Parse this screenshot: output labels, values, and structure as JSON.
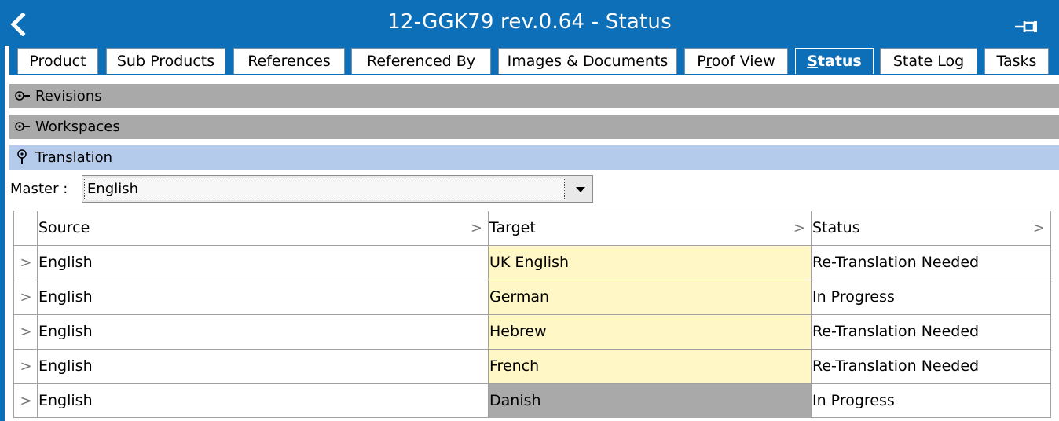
{
  "window": {
    "title": "12-GGK79 rev.0.64 - Status",
    "back_icon": "chevron-left-icon",
    "pin_icon": "pin-icon",
    "accent_color": "#0d6fb8"
  },
  "tabs": [
    {
      "label": "Product",
      "active": false
    },
    {
      "label": "Sub Products",
      "active": false
    },
    {
      "label": "References",
      "active": false
    },
    {
      "label": "Referenced By",
      "active": false
    },
    {
      "label": "Images & Documents",
      "active": false
    },
    {
      "label": "Proof View",
      "active": false
    },
    {
      "label": "Status",
      "active": true
    },
    {
      "label": "State Log",
      "active": false
    },
    {
      "label": "Tasks",
      "active": false
    }
  ],
  "sections": [
    {
      "label": "Revisions",
      "expanded": false
    },
    {
      "label": "Workspaces",
      "expanded": false
    },
    {
      "label": "Translation",
      "expanded": true
    }
  ],
  "translation": {
    "master_label": "Master :",
    "master_value": "English",
    "columns": [
      "Source",
      "Target",
      "Status"
    ],
    "rows": [
      {
        "source": "English",
        "target": "UK English",
        "status": "Re-Translation Needed",
        "target_highlight": "#fff7c6"
      },
      {
        "source": "English",
        "target": "German",
        "status": "In Progress",
        "target_highlight": "#fff7c6"
      },
      {
        "source": "English",
        "target": "Hebrew",
        "status": "Re-Translation Needed",
        "target_highlight": "#fff7c6"
      },
      {
        "source": "English",
        "target": "French",
        "status": "Re-Translation Needed",
        "target_highlight": "#fff7c6"
      },
      {
        "source": "English",
        "target": "Danish",
        "status": "In Progress",
        "target_highlight": "#a9a9a9"
      }
    ]
  }
}
